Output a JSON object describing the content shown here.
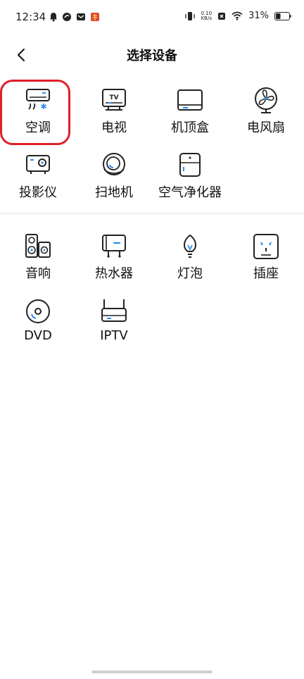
{
  "status_bar": {
    "time": "12:34",
    "net_speed_value": "0.10",
    "net_speed_unit": "KB/s",
    "battery": "31%"
  },
  "header": {
    "title": "选择设备"
  },
  "section1": {
    "items": [
      {
        "label": "空调",
        "icon": "air-conditioner-icon"
      },
      {
        "label": "电视",
        "icon": "tv-icon"
      },
      {
        "label": "机顶盒",
        "icon": "set-top-box-icon"
      },
      {
        "label": "电风扇",
        "icon": "fan-icon"
      },
      {
        "label": "投影仪",
        "icon": "projector-icon"
      },
      {
        "label": "扫地机",
        "icon": "robot-vacuum-icon"
      },
      {
        "label": "空气净化器",
        "icon": "air-purifier-icon"
      }
    ]
  },
  "section2": {
    "items": [
      {
        "label": "音响",
        "icon": "speaker-icon"
      },
      {
        "label": "热水器",
        "icon": "water-heater-icon"
      },
      {
        "label": "灯泡",
        "icon": "light-bulb-icon"
      },
      {
        "label": "插座",
        "icon": "socket-icon"
      },
      {
        "label": "DVD",
        "icon": "dvd-icon"
      },
      {
        "label": "IPTV",
        "icon": "iptv-icon"
      }
    ]
  },
  "colors": {
    "accent": "#2d8cf0",
    "highlight": "#e0202a",
    "icon_stroke": "#222222"
  }
}
